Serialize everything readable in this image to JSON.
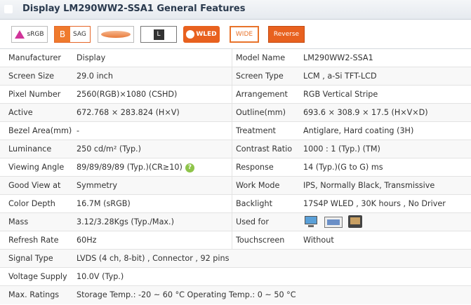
{
  "header": {
    "title": "Display LM290WW2-SSA1 General Features"
  },
  "badges": {
    "srgb": "sRGB",
    "sag_letter": "B",
    "sag": "SAG",
    "l": "L",
    "wled": "WLED",
    "wide": "WIDE",
    "reverse": "Reverse"
  },
  "specs": {
    "manufacturer": {
      "label": "Manufacturer",
      "value": "Display"
    },
    "model_name": {
      "label": "Model Name",
      "value": "LM290WW2-SSA1"
    },
    "screen_size": {
      "label": "Screen Size",
      "value": "29.0 inch"
    },
    "screen_type": {
      "label": "Screen Type",
      "value": "LCM ,   a-Si TFT-LCD"
    },
    "pixel_number": {
      "label": "Pixel Number",
      "value": "2560(RGB)×1080   (CSHD)"
    },
    "arrangement": {
      "label": "Arrangement",
      "value": "RGB Vertical Stripe"
    },
    "active": {
      "label": "Active",
      "value": "672.768 × 283.824 (H×V)"
    },
    "outline": {
      "label": "Outline(mm)",
      "value": "693.6 × 308.9 × 17.5 (H×V×D)"
    },
    "bezel_area": {
      "label": "Bezel Area(mm)",
      "value": "-"
    },
    "treatment": {
      "label": "Treatment",
      "value": "Antiglare, Hard coating (3H)"
    },
    "luminance": {
      "label": "Luminance",
      "value": "250 cd/m² (Typ.)"
    },
    "contrast_ratio": {
      "label": "Contrast Ratio",
      "value": "1000 : 1 (Typ.) (TM)"
    },
    "viewing_angle": {
      "label": "Viewing Angle",
      "value": "89/89/89/89 (Typ.)(CR≥10)",
      "help": "?"
    },
    "response": {
      "label": "Response",
      "value": "14 (Typ.)(G to G) ms"
    },
    "good_view_at": {
      "label": "Good View at",
      "value": "Symmetry"
    },
    "work_mode": {
      "label": "Work Mode",
      "value": "IPS, Normally Black, Transmissive"
    },
    "color_depth": {
      "label": "Color Depth",
      "value": "16.7M    (sRGB)"
    },
    "backlight": {
      "label": "Backlight",
      "value": "17S4P WLED , 30K hours , No Driver"
    },
    "mass": {
      "label": "Mass",
      "value": "3.12/3.28Kgs (Typ./Max.)"
    },
    "used_for": {
      "label": "Used for",
      "icons": [
        "monitor-icon",
        "panel-icon",
        "tv-icon"
      ]
    },
    "refresh_rate": {
      "label": "Refresh Rate",
      "value": "60Hz"
    },
    "touchscreen": {
      "label": "Touchscreen",
      "value": "Without"
    },
    "signal_type": {
      "label": "Signal Type",
      "value": "LVDS (4 ch, 8-bit) , Connector , 92 pins"
    },
    "voltage_supply": {
      "label": "Voltage Supply",
      "value": "10.0V (Typ.)"
    },
    "max_ratings": {
      "label": "Max. Ratings",
      "value": "Storage Temp.: -20 ~ 60 °C     Operating Temp.: 0 ~ 50 °C"
    }
  }
}
